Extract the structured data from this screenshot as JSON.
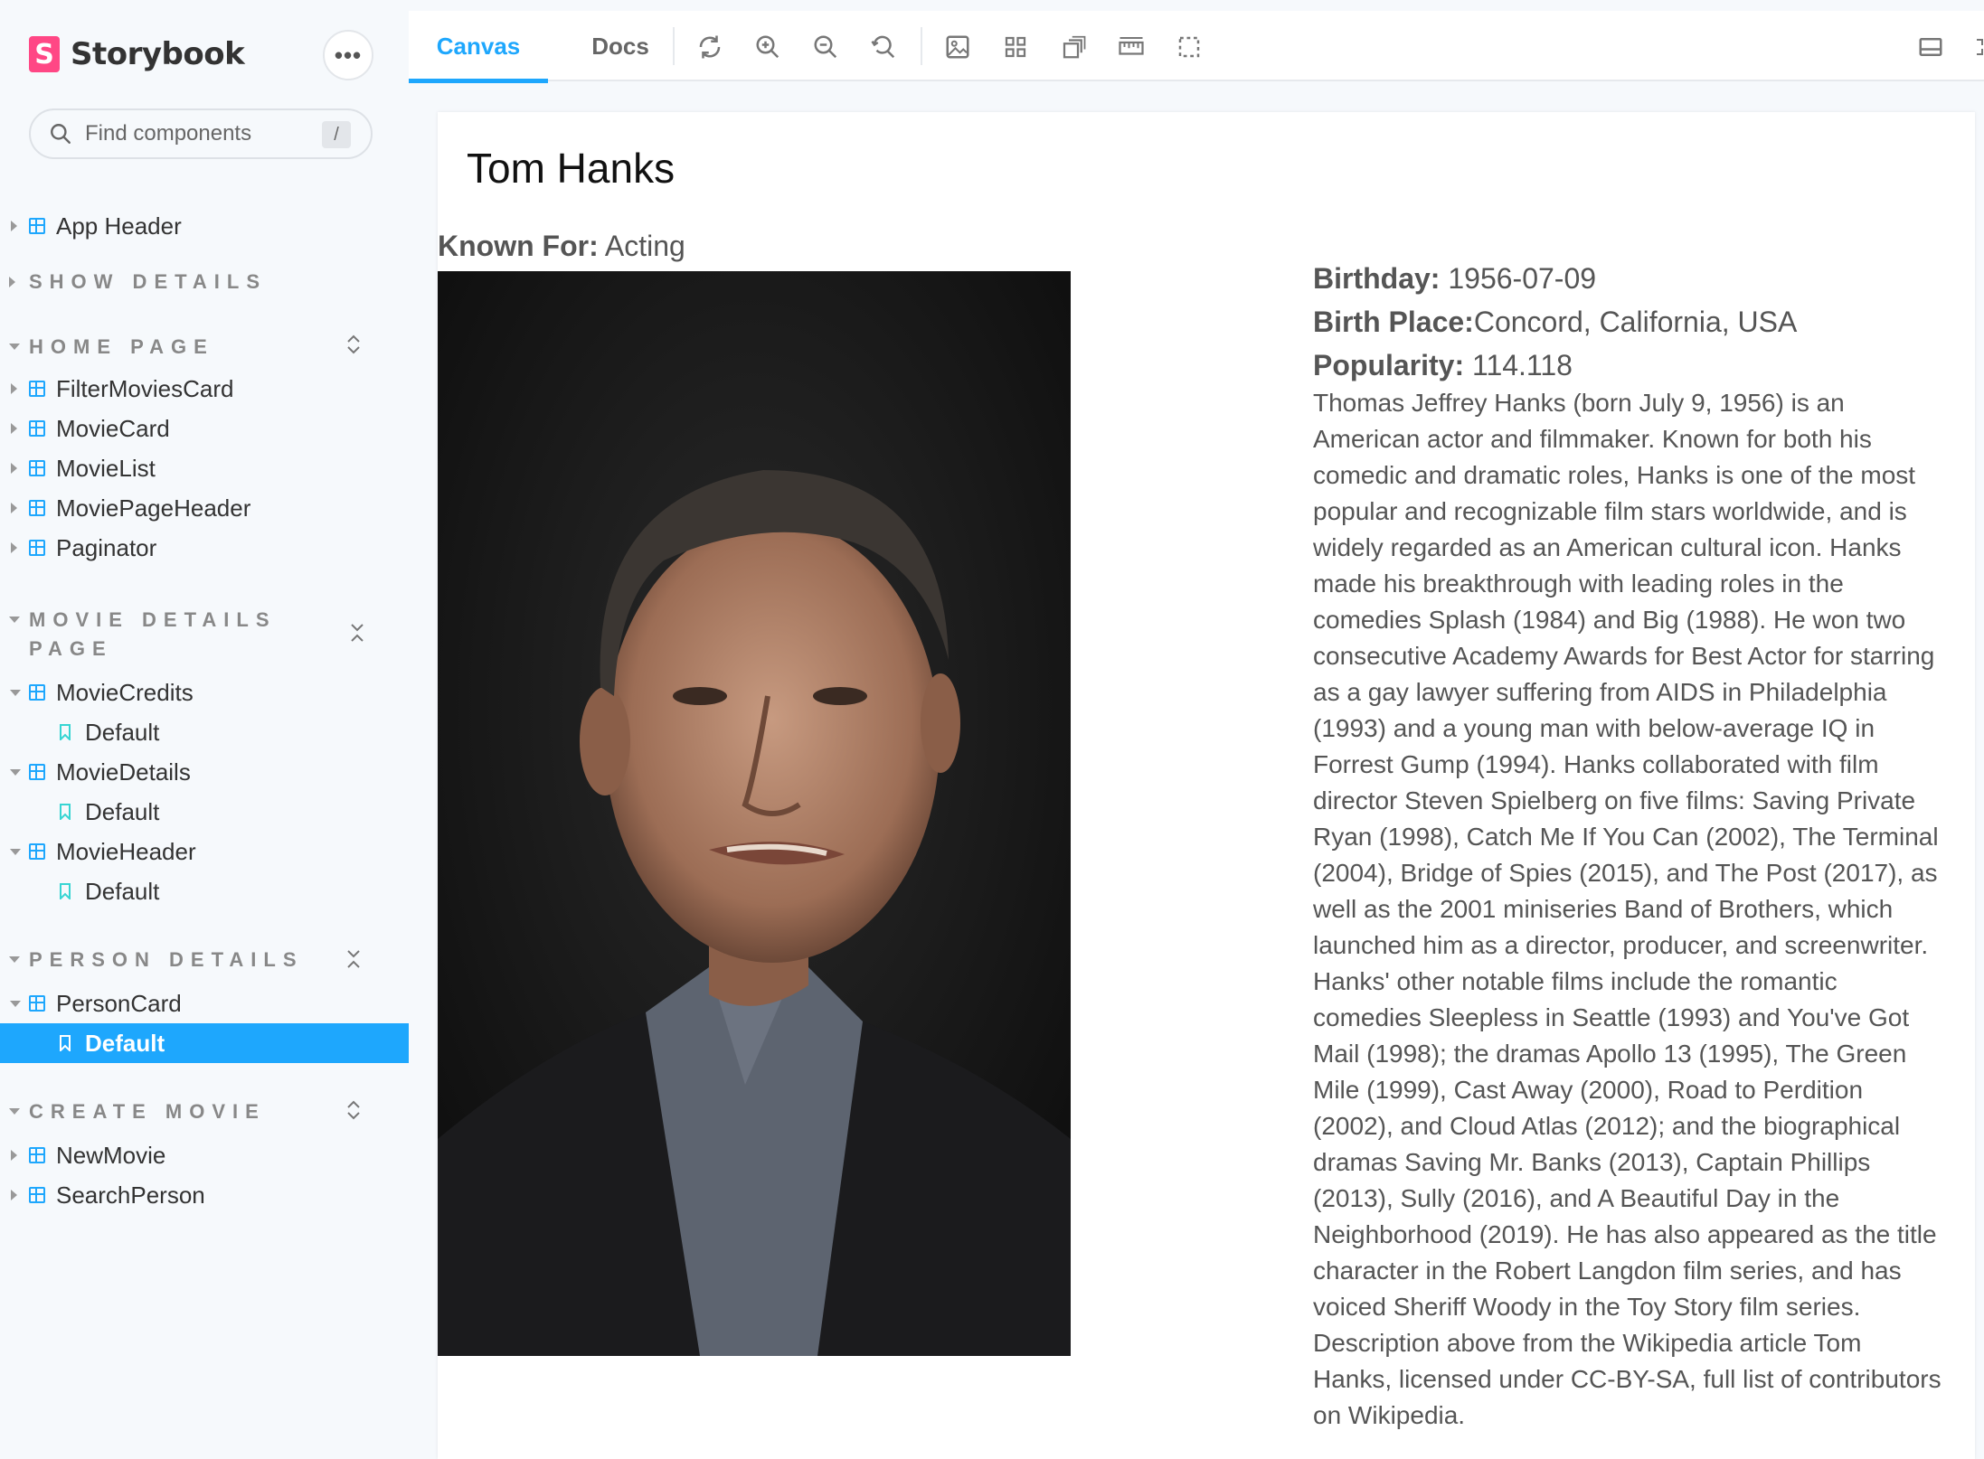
{
  "app": {
    "name": "Storybook",
    "logo_letter": "S",
    "menu_dots": "•••"
  },
  "search": {
    "placeholder": "Find components",
    "shortcut": "/"
  },
  "sidebar": {
    "app_header": "App Header",
    "groups": {
      "show_details": "SHOW DETAILS",
      "home_page": "HOME PAGE",
      "movie_details_line1": "MOVIE DETAILS",
      "movie_details_line2": "PAGE",
      "person_details": "PERSON DETAILS",
      "create_movie": "CREATE MOVIE"
    },
    "home_items": [
      "FilterMoviesCard",
      "MovieCard",
      "MovieList",
      "MoviePageHeader",
      "Paginator"
    ],
    "movie_details_items": {
      "credits": "MovieCredits",
      "credits_story": "Default",
      "details": "MovieDetails",
      "details_story": "Default",
      "header": "MovieHeader",
      "header_story": "Default"
    },
    "person_items": {
      "card": "PersonCard",
      "card_story": "Default"
    },
    "create_items": [
      "NewMovie",
      "SearchPerson"
    ]
  },
  "toolbar": {
    "tabs": {
      "canvas": "Canvas",
      "docs": "Docs"
    }
  },
  "colors": {
    "accent": "#1ea7fd",
    "brand": "#ff4785"
  },
  "person": {
    "name": "Tom Hanks",
    "known_for_label": "Known For:",
    "known_for_value": "Acting",
    "birthday_label": "Birthday:",
    "birthday_value": "1956-07-09",
    "birthplace_label": "Birth Place:",
    "birthplace_value": "Concord, California, USA",
    "popularity_label": "Popularity:",
    "popularity_value": "114.118",
    "biography": "Thomas Jeffrey Hanks (born July 9, 1956) is an American actor and filmmaker. Known for both his comedic and dramatic roles, Hanks is one of the most popular and recognizable film stars worldwide, and is widely regarded as an American cultural icon. Hanks made his breakthrough with leading roles in the comedies Splash (1984) and Big (1988). He won two consecutive Academy Awards for Best Actor for starring as a gay lawyer suffering from AIDS in Philadelphia (1993) and a young man with below-average IQ in Forrest Gump (1994). Hanks collaborated with film director Steven Spielberg on five films: Saving Private Ryan (1998), Catch Me If You Can (2002), The Terminal (2004), Bridge of Spies (2015), and The Post (2017), as well as the 2001 miniseries Band of Brothers, which launched him as a director, producer, and screenwriter. Hanks' other notable films include the romantic comedies Sleepless in Seattle (1993) and You've Got Mail (1998); the dramas Apollo 13 (1995), The Green Mile (1999), Cast Away (2000), Road to Perdition (2002), and Cloud Atlas (2012); and the biographical dramas Saving Mr. Banks (2013), Captain Phillips (2013), Sully (2016), and A Beautiful Day in the Neighborhood (2019). He has also appeared as the title character in the Robert Langdon film series, and has voiced Sheriff Woody in the Toy Story film series. Description above from the Wikipedia article Tom Hanks, licensed under CC-BY-SA, full list of contributors on Wikipedia."
  }
}
